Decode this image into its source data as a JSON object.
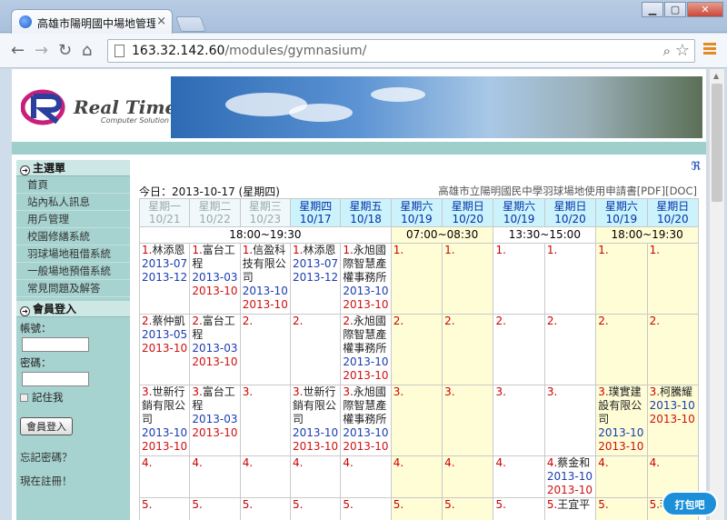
{
  "browser": {
    "tab_title": "高雄市陽明國中場地管理系統",
    "tab_close": "×",
    "url_host": "163.32.142.60",
    "url_path": "/modules/gymnasium/",
    "window_min": "▁",
    "window_max": "▢",
    "window_close": "✕"
  },
  "header": {
    "logo_text": "Real Time",
    "logo_sub": "Computer Solution"
  },
  "sidebar": {
    "menu_title": "主選單",
    "items": [
      "首頁",
      "站內私人訊息",
      "用戶管理",
      "校園修繕系統",
      "羽球場地租借系統",
      "一般場地預借系統",
      "常見問題及解答"
    ],
    "login_title": "會員登入",
    "account_label": "帳號：",
    "password_label": "密碼：",
    "remember_label": "記住我",
    "login_button": "會員登入",
    "forgot_link": "忘記密碼？",
    "register_link": "現在註冊！"
  },
  "main": {
    "today": "今日：2013-10-17 (星期四)",
    "form_title": "高雄市立陽明國民中學羽球場地使用申請書[PDF][DOC]",
    "days": [
      {
        "name": "星期一",
        "date": "10/21",
        "state": "past"
      },
      {
        "name": "星期二",
        "date": "10/22",
        "state": "past"
      },
      {
        "name": "星期三",
        "date": "10/23",
        "state": "past"
      },
      {
        "name": "星期四",
        "date": "10/17",
        "state": "cur"
      },
      {
        "name": "星期五",
        "date": "10/18",
        "state": "cur"
      },
      {
        "name": "星期六",
        "date": "10/19",
        "state": "cur"
      },
      {
        "name": "星期日",
        "date": "10/20",
        "state": "cur"
      },
      {
        "name": "星期六",
        "date": "10/19",
        "state": "cur"
      },
      {
        "name": "星期日",
        "date": "10/20",
        "state": "cur"
      },
      {
        "name": "星期六",
        "date": "10/19",
        "state": "cur"
      },
      {
        "name": "星期日",
        "date": "10/20",
        "state": "cur"
      }
    ],
    "time_slots": [
      "18:00~19:30",
      "07:00~08:30",
      "13:30~15:00",
      "18:00~19:30"
    ],
    "rows": [
      [
        {
          "n": "1.",
          "name": "林添恩",
          "dates": [
            [
              "2013-07",
              "b"
            ],
            [
              "2013-12",
              "b"
            ]
          ]
        },
        {
          "n": "1.",
          "name": "富台工程",
          "dates": [
            [
              "2013-03",
              "b"
            ],
            [
              "2013-10",
              "r"
            ]
          ]
        },
        {
          "n": "1.",
          "name": "信盈科技有限公司",
          "dates": [
            [
              "2013-10",
              "b"
            ],
            [
              "2013-10",
              "r"
            ]
          ]
        },
        {
          "n": "1.",
          "name": "林添恩",
          "dates": [
            [
              "2013-07",
              "b"
            ],
            [
              "2013-12",
              "b"
            ]
          ]
        },
        {
          "n": "1.",
          "name": "永旭國際智慧產權事務所",
          "dates": [
            [
              "2013-10",
              "b"
            ],
            [
              "2013-10",
              "r"
            ]
          ]
        },
        {
          "n": "1.",
          "name": "",
          "dates": []
        },
        {
          "n": "1.",
          "name": "",
          "dates": []
        },
        {
          "n": "1.",
          "name": "",
          "dates": []
        },
        {
          "n": "1.",
          "name": "",
          "dates": []
        },
        {
          "n": "1.",
          "name": "",
          "dates": []
        },
        {
          "n": "1.",
          "name": "",
          "dates": []
        }
      ],
      [
        {
          "n": "2.",
          "name": "蔡仲凱",
          "dates": [
            [
              "2013-05",
              "b"
            ],
            [
              "2013-10",
              "r"
            ]
          ]
        },
        {
          "n": "2.",
          "name": "富台工程",
          "dates": [
            [
              "2013-03",
              "b"
            ],
            [
              "2013-10",
              "r"
            ]
          ]
        },
        {
          "n": "2.",
          "name": "",
          "dates": []
        },
        {
          "n": "2.",
          "name": "",
          "dates": []
        },
        {
          "n": "2.",
          "name": "永旭國際智慧產權事務所",
          "dates": [
            [
              "2013-10",
              "b"
            ],
            [
              "2013-10",
              "r"
            ]
          ]
        },
        {
          "n": "2.",
          "name": "",
          "dates": []
        },
        {
          "n": "2.",
          "name": "",
          "dates": []
        },
        {
          "n": "2.",
          "name": "",
          "dates": []
        },
        {
          "n": "2.",
          "name": "",
          "dates": []
        },
        {
          "n": "2.",
          "name": "",
          "dates": []
        },
        {
          "n": "2.",
          "name": "",
          "dates": []
        }
      ],
      [
        {
          "n": "3.",
          "name": "世新行銷有限公司",
          "dates": [
            [
              "2013-10",
              "b"
            ],
            [
              "2013-10",
              "r"
            ]
          ]
        },
        {
          "n": "3.",
          "name": "富台工程",
          "dates": [
            [
              "2013-03",
              "b"
            ],
            [
              "2013-10",
              "r"
            ]
          ]
        },
        {
          "n": "3.",
          "name": "",
          "dates": []
        },
        {
          "n": "3.",
          "name": "世新行銷有限公司",
          "dates": [
            [
              "2013-10",
              "b"
            ],
            [
              "2013-10",
              "r"
            ]
          ]
        },
        {
          "n": "3.",
          "name": "永旭國際智慧產權事務所",
          "dates": [
            [
              "2013-10",
              "b"
            ],
            [
              "2013-10",
              "r"
            ]
          ]
        },
        {
          "n": "3.",
          "name": "",
          "dates": []
        },
        {
          "n": "3.",
          "name": "",
          "dates": []
        },
        {
          "n": "3.",
          "name": "",
          "dates": []
        },
        {
          "n": "3.",
          "name": "",
          "dates": []
        },
        {
          "n": "3.",
          "name": "璞實建設有限公司",
          "dates": [
            [
              "2013-10",
              "b"
            ],
            [
              "2013-10",
              "r"
            ]
          ]
        },
        {
          "n": "3.",
          "name": "柯騰耀",
          "dates": [
            [
              "2013-10",
              "b"
            ],
            [
              "2013-10",
              "r"
            ]
          ]
        }
      ],
      [
        {
          "n": "4.",
          "name": "",
          "dates": []
        },
        {
          "n": "4.",
          "name": "",
          "dates": []
        },
        {
          "n": "4.",
          "name": "",
          "dates": []
        },
        {
          "n": "4.",
          "name": "",
          "dates": []
        },
        {
          "n": "4.",
          "name": "",
          "dates": []
        },
        {
          "n": "4.",
          "name": "",
          "dates": []
        },
        {
          "n": "4.",
          "name": "",
          "dates": []
        },
        {
          "n": "4.",
          "name": "",
          "dates": []
        },
        {
          "n": "4.",
          "name": "蔡金和",
          "dates": [
            [
              "2013-10",
              "b"
            ],
            [
              "2013-10",
              "r"
            ]
          ]
        },
        {
          "n": "4.",
          "name": "",
          "dates": []
        },
        {
          "n": "4.",
          "name": "",
          "dates": []
        }
      ],
      [
        {
          "n": "5.",
          "name": "",
          "dates": []
        },
        {
          "n": "5.",
          "name": "",
          "dates": []
        },
        {
          "n": "5.",
          "name": "",
          "dates": []
        },
        {
          "n": "5.",
          "name": "",
          "dates": []
        },
        {
          "n": "5.",
          "name": "",
          "dates": []
        },
        {
          "n": "5.",
          "name": "",
          "dates": []
        },
        {
          "n": "5.",
          "name": "",
          "dates": []
        },
        {
          "n": "5.",
          "name": "",
          "dates": []
        },
        {
          "n": "5.",
          "name": "王宜平",
          "dates": []
        },
        {
          "n": "5.",
          "name": "",
          "dates": []
        },
        {
          "n": "5.",
          "name": "李美",
          "dates": []
        }
      ]
    ]
  },
  "watermark": "打包吧",
  "colors": {
    "teal": "#a6d2cf",
    "yellow": "#fefdd5",
    "blue_text": "#1a3cb3",
    "red_text": "#d01010"
  }
}
